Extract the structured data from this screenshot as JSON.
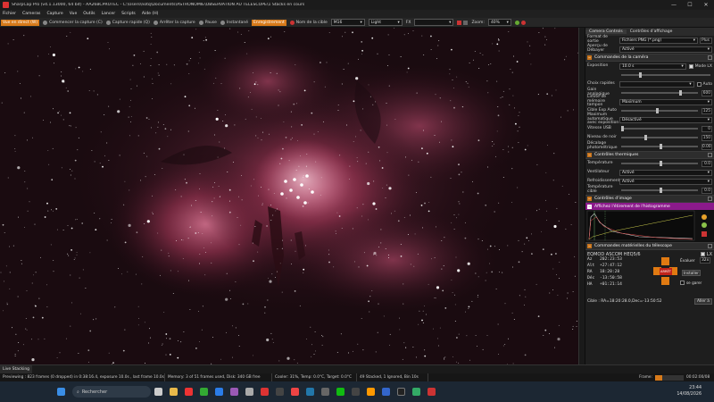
{
  "window": {
    "title": "SharpCap Pro (v4.1.13000, 64 bit) - AA26BCPROTEC - C:\\Users\\notq\\Documents\\ASTRONOMIE\\OBSERVATION AU TELESCOPE\\1 Stacks en cours",
    "minimize": "—",
    "maximize": "☐",
    "close": "✕"
  },
  "menu": [
    "Fichier",
    "Cameras",
    "Capture",
    "Vue",
    "Outils",
    "Lancer",
    "Scripts",
    "Aide (H)"
  ],
  "toolbar": {
    "live_view": "Vue en direct (W)",
    "start_capture": "Commencer la capture (C)",
    "quick_capture": "Capture rapide (Q)",
    "stop_capture": "Arrêter la capture",
    "pause": "Pause",
    "snapshot": "Instantané",
    "save": "Enregistrement",
    "target_name_label": "Nom de la cible",
    "target_name": "M16",
    "frame_type": "Light",
    "fx_label": "FX",
    "zoom_label": "Zoom:",
    "zoom_value": "40%"
  },
  "panel": {
    "tabs": [
      "Camera Controls",
      "Contrôles d'affichage"
    ],
    "top_rows": [
      {
        "label": "Format de sortie",
        "value": "Fichiers PNG (*.png)",
        "extra": "Plus"
      },
      {
        "label": "Aperçu de Débayer",
        "value": "Activé"
      }
    ],
    "camera_section": "Commandes de la caméra",
    "exposure": {
      "label": "Exposition",
      "value": "10.0 s",
      "lx_label": "Mode LX"
    },
    "quick_choice": {
      "label": "Choix rapides",
      "auto": "Auto"
    },
    "camera_rows": [
      {
        "label": "Gain analogique",
        "num": "600"
      },
      {
        "label": "Limite de mémoire tampon",
        "value": "Maximum"
      },
      {
        "label": "Cible Exp Auto",
        "num": "125"
      },
      {
        "label": "Maximum automatique avec exposition",
        "value": "Désactivé"
      },
      {
        "label": "Vitesse USB",
        "num": "0"
      },
      {
        "label": "Niveau de noir",
        "num": "150"
      },
      {
        "label": "Décalage photométrique",
        "num": "0.00"
      }
    ],
    "thermal_section": "Contrôles thermiques",
    "thermal_rows": [
      {
        "label": "Température",
        "num": "0.0"
      },
      {
        "label": "Ventilateur",
        "value": "Activé"
      },
      {
        "label": "Refroidissement",
        "value": "Activé"
      },
      {
        "label": "Température cible",
        "num": "0.0"
      }
    ],
    "image_section": "Contrôles d'image",
    "histogram_label": "Affichez l'étirement de l'histogramme",
    "mount_section": "Commandes matérielles du télescope",
    "mount_name": "EQMOD ASCOM HEQ5/6",
    "mount_track": "LX",
    "mount_lines": [
      {
        "k": "Az",
        "v": "202:23:53"
      },
      {
        "k": "Alt",
        "v": "+27:47:12"
      },
      {
        "k": "RA",
        "v": "18:20:28"
      },
      {
        "k": "Déc",
        "v": "-13:50:58"
      },
      {
        "k": "HA",
        "v": "+01:21:14"
      }
    ],
    "mount_stop": "ARRÊT",
    "mount_track_label": "Évaluer",
    "mount_rate": "32x",
    "mount_install": "Installer",
    "mount_park": "se garer",
    "mount_target": "Cible : RA=18:20:28.0,Dec=-13:50:52",
    "mount_goto": "Aller à"
  },
  "status": {
    "live_stack_tab": "Live Stacking",
    "previewing": "Previewing : 823 frames (0 dropped) in 0:38:16.4, exposure 10.0s , last frame 10.0s",
    "memory": "Memory: 3 of 51 frames used, Disk: 340 GB free",
    "cooler": "Cooler: 31%, Temp: 0.0°C, Target: 0.0°C",
    "stacked": "49 Stacked, 1 Ignored, Bin 10s",
    "frame_label": "Frame:",
    "elapsed": "00:02:00/08"
  },
  "taskbar": {
    "search_placeholder": "Rechercher",
    "time": "23:44",
    "date": "14/08/2026"
  },
  "colors": {
    "accent_orange": "#d77a1a",
    "record_red": "#b2341f",
    "histogram_magenta": "#8b1a8b"
  }
}
